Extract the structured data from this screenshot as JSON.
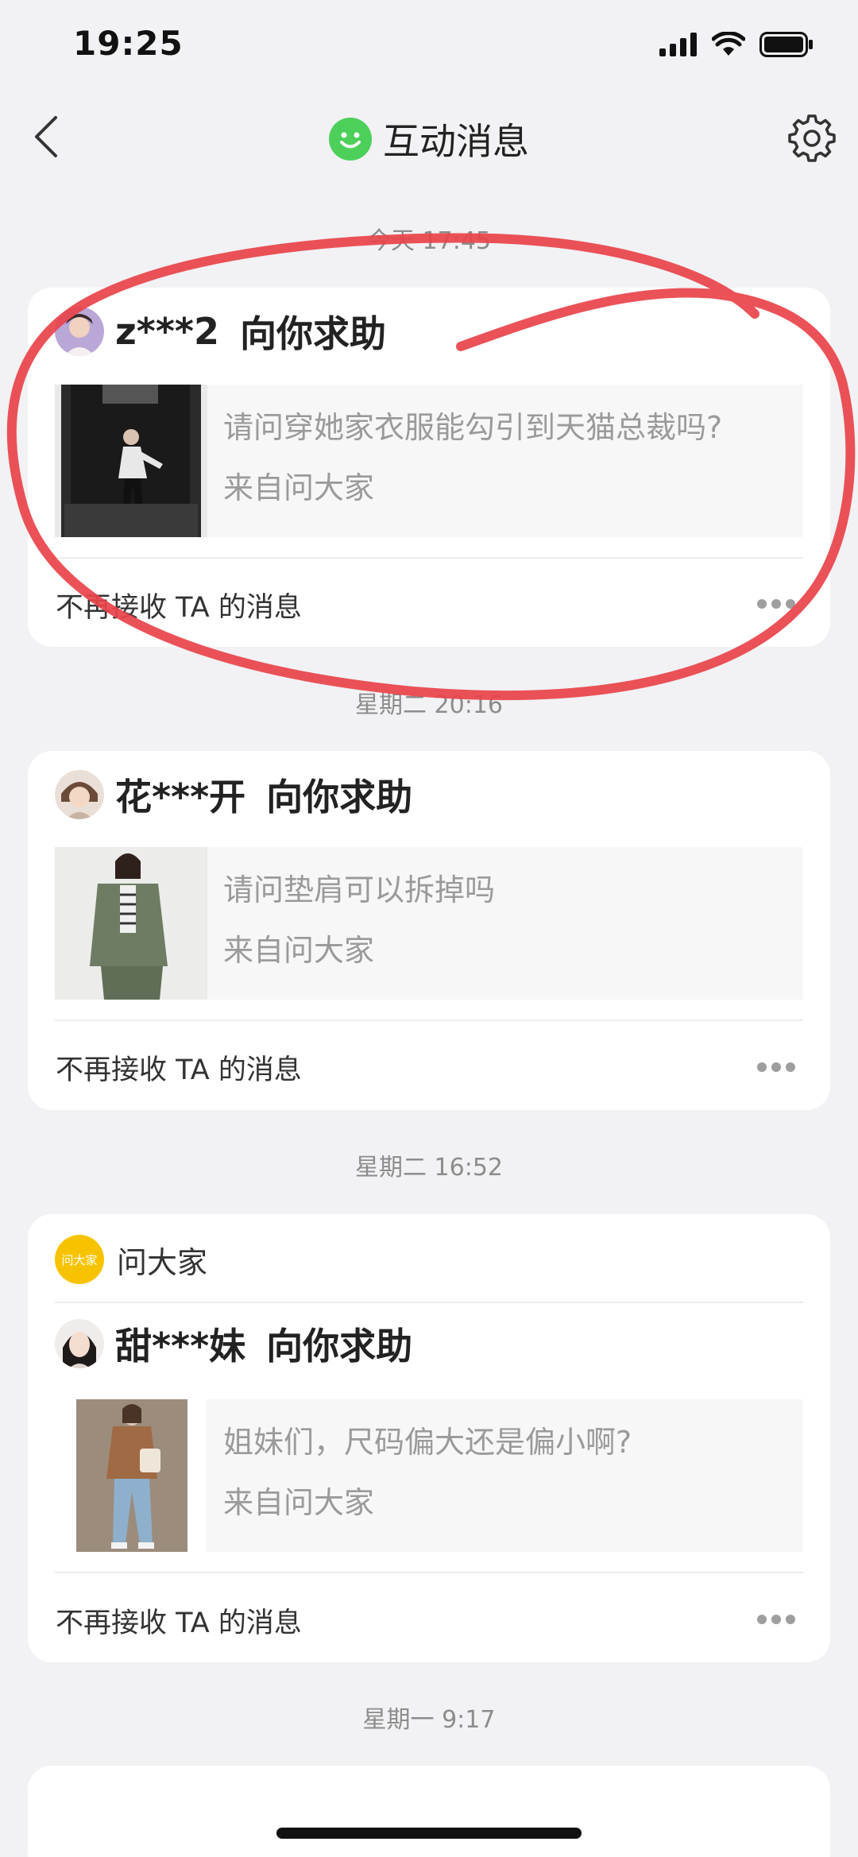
{
  "status_bar": {
    "time": "19:25",
    "icons": [
      "signal-icon",
      "wifi-icon",
      "battery-icon"
    ]
  },
  "nav": {
    "title": "互动消息",
    "icons": [
      "back-arrow-icon",
      "smiley-logo-icon",
      "settings-icon"
    ]
  },
  "messages": [
    {
      "time": "今天 17:45",
      "user": "z***2",
      "action": "向你求助",
      "question": "请问穿她家衣服能勾引到天猫总裁吗?",
      "source": "来自问大家",
      "unsubscribe": "不再接收 TA 的消息"
    },
    {
      "time": "星期二 20:16",
      "user": "花***开",
      "action": "向你求助",
      "question": "请问垫肩可以拆掉吗",
      "source": "来自问大家",
      "unsubscribe": "不再接收 TA 的消息"
    },
    {
      "time": "星期二 16:52",
      "group_source": "问大家",
      "group_badge": "问大家",
      "user": "甜***妹",
      "action": "向你求助",
      "question": "姐妹们，尺码偏大还是偏小啊?",
      "source": "来自问大家",
      "unsubscribe": "不再接收 TA 的消息"
    },
    {
      "time": "星期一 9:17"
    }
  ],
  "colors": {
    "background": "#f2f1f3",
    "card": "#ffffff",
    "logo_green": "#4cd05a",
    "badge_yellow": "#f7c300",
    "annotation_red": "#e8434a"
  }
}
